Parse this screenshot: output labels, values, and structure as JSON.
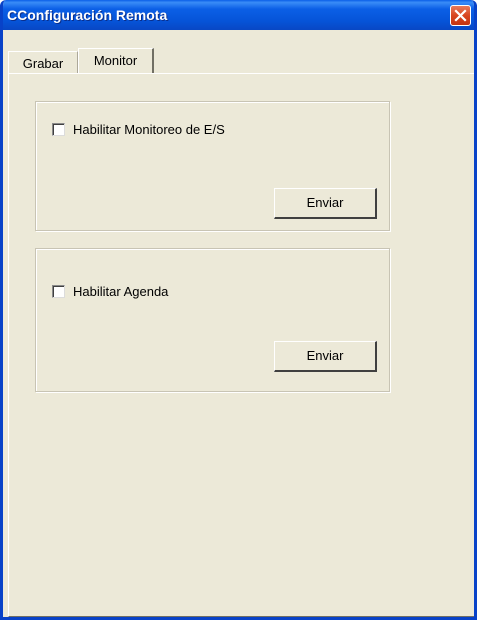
{
  "window": {
    "title": "CConfiguración Remota"
  },
  "tabs": [
    {
      "label": "Grabar",
      "selected": false
    },
    {
      "label": "Monitor",
      "selected": true
    }
  ],
  "monitor_panel": {
    "io_monitoring": {
      "checkbox_label": "Habilitar Monitoreo de E/S",
      "checked": false,
      "button_label": "Enviar"
    },
    "schedule": {
      "checkbox_label": "Habilitar Agenda",
      "checked": false,
      "button_label": "Enviar"
    }
  },
  "colors": {
    "titlebar": "#0654d8",
    "window_bg": "#ece9d8",
    "close_button": "#d8451f"
  },
  "icons": {
    "close": "close-icon"
  }
}
